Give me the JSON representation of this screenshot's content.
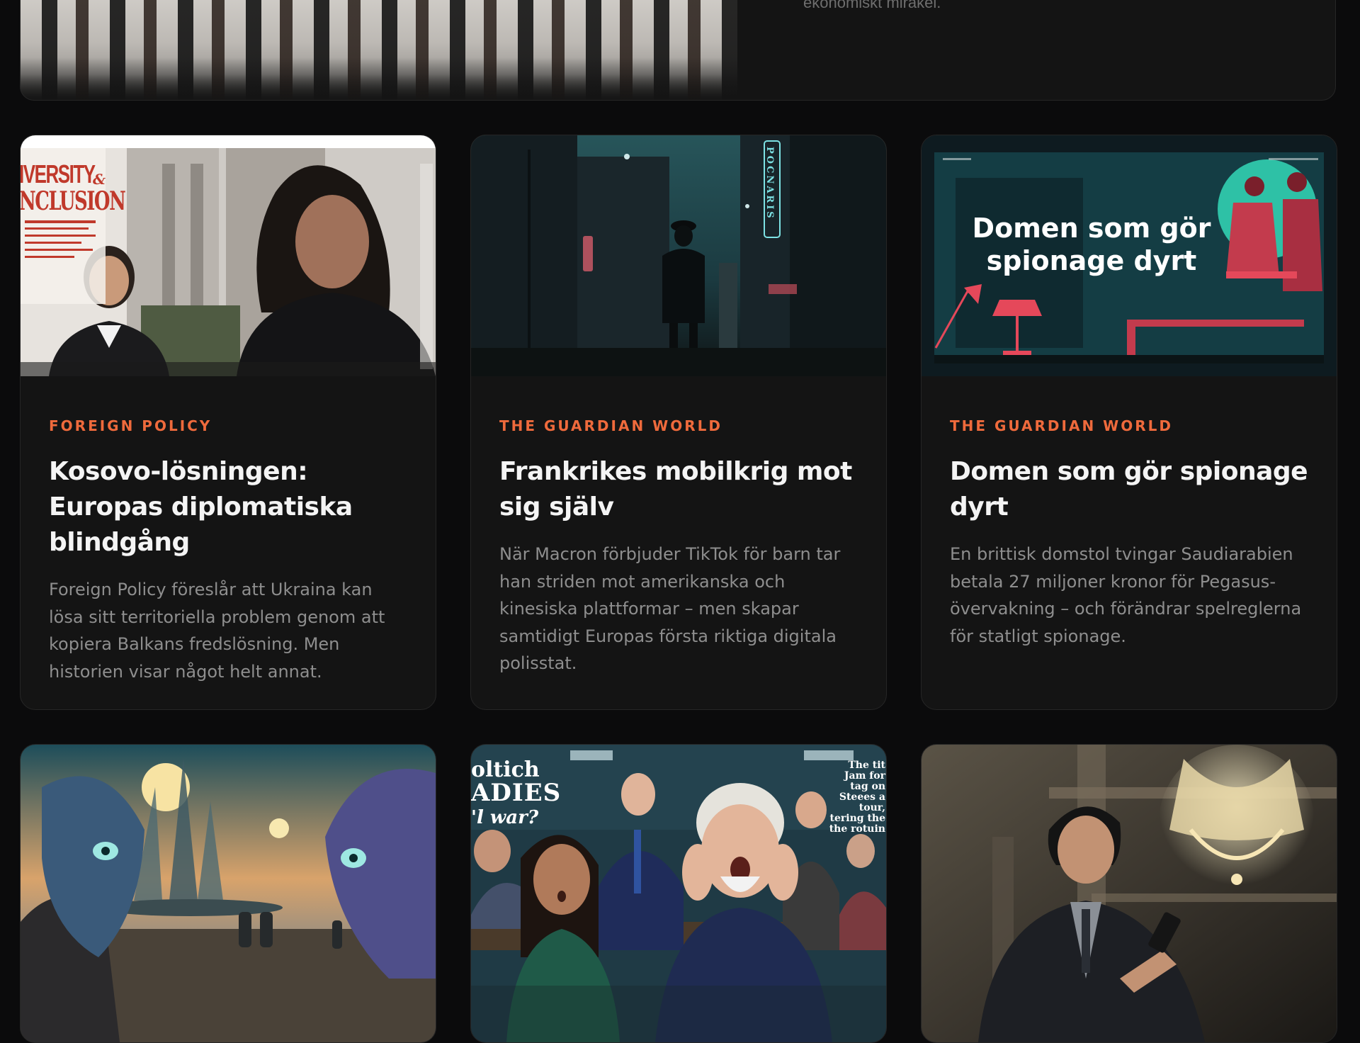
{
  "featured": {
    "excerpt_fragment": "ekonomiskt mirakel."
  },
  "cards": [
    {
      "source": "FOREIGN POLICY",
      "title": "Kosovo-lösningen: Europas diplomatiska blindgång",
      "excerpt": "Foreign Policy föreslår att Ukraina kan lösa sitt territoriella problem genom att kopiera Balkans fredslösning. Men historien visar något helt annat.",
      "image_text": {
        "cover_line1": "IVERSITY",
        "cover_amp": "&",
        "cover_line2": "NCLUSION"
      }
    },
    {
      "source": "THE GUARDIAN WORLD",
      "title": "Frankrikes mobilkrig mot sig själv",
      "excerpt": "När Macron förbjuder TikTok för barn tar han striden mot amerikanska och kinesiska plattformar – men skapar samtidigt Europas första riktiga digitala polisstat.",
      "image_text": {
        "sign": "POCNARIS"
      }
    },
    {
      "source": "THE GUARDIAN WORLD",
      "title": "Domen som gör spionage dyrt",
      "excerpt": "En brittisk domstol tvingar Saudiarabien betala 27 miljoner kronor för Pegasus-övervakning – och förändrar spelreglerna för statligt spionage.",
      "image_text": {
        "headline": "Domen som gör spionage dyrt"
      }
    },
    {
      "source": "",
      "title": "",
      "excerpt": "",
      "image_text": {}
    },
    {
      "source": "",
      "title": "",
      "excerpt": "",
      "image_text": {
        "cover_line1": "oltich",
        "cover_line2": "ADIES",
        "cover_line3": "'l war?",
        "side_text": "The tit Jam for tag on Steees a tour, tering the the rotuin"
      }
    },
    {
      "source": "",
      "title": "",
      "excerpt": "",
      "image_text": {}
    }
  ],
  "colors": {
    "background": "#0b0b0c",
    "card": "#141414",
    "accent": "#ef6a3c",
    "title": "#f4f4f4",
    "excerpt": "#8e8e8e"
  }
}
